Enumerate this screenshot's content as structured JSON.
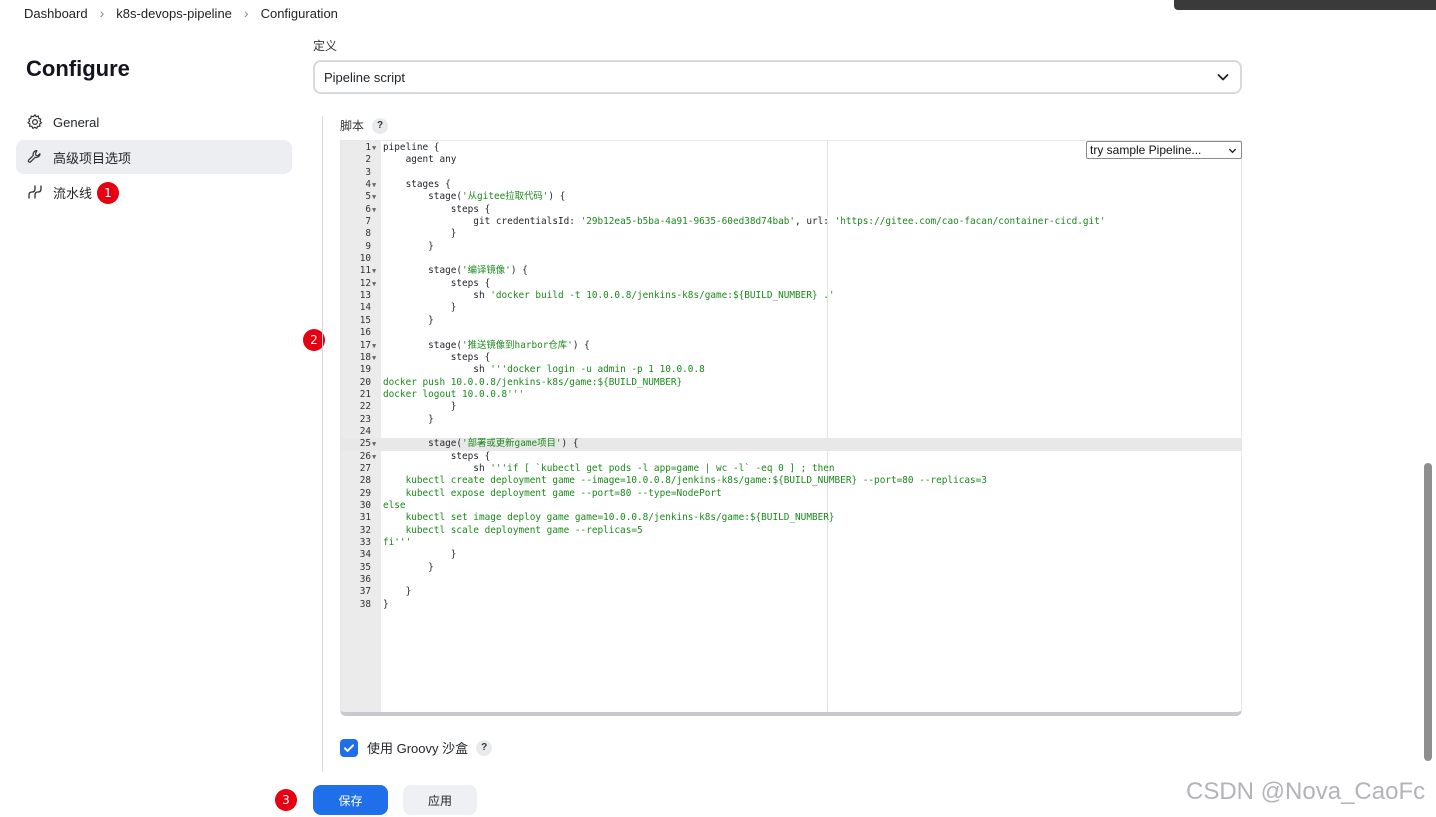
{
  "breadcrumb": [
    "Dashboard",
    "k8s-devops-pipeline",
    "Configuration"
  ],
  "page_title": "Configure",
  "sidenav": [
    {
      "label": "General",
      "icon": "gear-icon"
    },
    {
      "label": "高级项目选项",
      "icon": "wrench-icon",
      "active": true
    },
    {
      "label": "流水线",
      "icon": "pipeline-icon"
    }
  ],
  "badges": [
    "1",
    "2",
    "3"
  ],
  "definition": {
    "label": "定义",
    "value": "Pipeline script"
  },
  "script": {
    "label": "脚本",
    "help": "?",
    "sample_select": "try sample Pipeline...",
    "highlighted_line": 25,
    "lines": [
      {
        "n": "1",
        "fold": true,
        "code": "pipeline {"
      },
      {
        "n": "2",
        "code": "    agent any"
      },
      {
        "n": "3",
        "code": ""
      },
      {
        "n": "4",
        "fold": true,
        "code": "    stages {"
      },
      {
        "n": "5",
        "fold": true,
        "code": "        stage('从gitee拉取代码') {"
      },
      {
        "n": "6",
        "fold": true,
        "code": "            steps {"
      },
      {
        "n": "7",
        "code": "                git credentialsId: '29b12ea5-b5ba-4a91-9635-60ed38d74bab', url: 'https://gitee.com/cao-facan/container-cicd.git'"
      },
      {
        "n": "8",
        "code": "            }"
      },
      {
        "n": "9",
        "code": "        }"
      },
      {
        "n": "10",
        "code": ""
      },
      {
        "n": "11",
        "fold": true,
        "code": "        stage('编译镜像') {"
      },
      {
        "n": "12",
        "fold": true,
        "code": "            steps {"
      },
      {
        "n": "13",
        "code": "                sh 'docker build -t 10.0.0.8/jenkins-k8s/game:${BUILD_NUMBER} .'"
      },
      {
        "n": "14",
        "code": "            }"
      },
      {
        "n": "15",
        "code": "        }"
      },
      {
        "n": "16",
        "code": ""
      },
      {
        "n": "17",
        "fold": true,
        "code": "        stage('推送镜像到harbor仓库') {"
      },
      {
        "n": "18",
        "fold": true,
        "code": "            steps {"
      },
      {
        "n": "19",
        "code": "                sh '''docker login -u admin -p 1 10.0.0.8"
      },
      {
        "n": "20",
        "code": "docker push 10.0.0.8/jenkins-k8s/game:${BUILD_NUMBER}"
      },
      {
        "n": "21",
        "code": "docker logout 10.0.0.8'''"
      },
      {
        "n": "22",
        "code": "            }"
      },
      {
        "n": "23",
        "code": "        }"
      },
      {
        "n": "24",
        "code": ""
      },
      {
        "n": "25",
        "fold": true,
        "code": "        stage('部署或更新game项目') {"
      },
      {
        "n": "26",
        "fold": true,
        "code": "            steps {"
      },
      {
        "n": "27",
        "code": "                sh '''if [ `kubectl get pods -l app=game | wc -l` -eq 0 ] ; then"
      },
      {
        "n": "28",
        "code": "    kubectl create deployment game --image=10.0.0.8/jenkins-k8s/game:${BUILD_NUMBER} --port=80 --replicas=3"
      },
      {
        "n": "29",
        "code": "    kubectl expose deployment game --port=80 --type=NodePort"
      },
      {
        "n": "30",
        "code": "else"
      },
      {
        "n": "31",
        "code": "    kubectl set image deploy game game=10.0.0.8/jenkins-k8s/game:${BUILD_NUMBER}"
      },
      {
        "n": "32",
        "code": "    kubectl scale deployment game --replicas=5"
      },
      {
        "n": "33",
        "code": "fi'''"
      },
      {
        "n": "34",
        "code": "            }"
      },
      {
        "n": "35",
        "code": "        }"
      },
      {
        "n": "36",
        "code": ""
      },
      {
        "n": "37",
        "code": "    }"
      },
      {
        "n": "38",
        "code": "}"
      }
    ]
  },
  "groovy_sandbox": {
    "label": "使用 Groovy 沙盒",
    "checked": true,
    "help": "?"
  },
  "footer": {
    "save_label": "保存",
    "apply_label": "应用"
  },
  "watermark": "CSDN @Nova_CaoFc",
  "colors": {
    "primary": "#1f6feb",
    "badge": "#e60012",
    "string": "#1a8a1a"
  }
}
